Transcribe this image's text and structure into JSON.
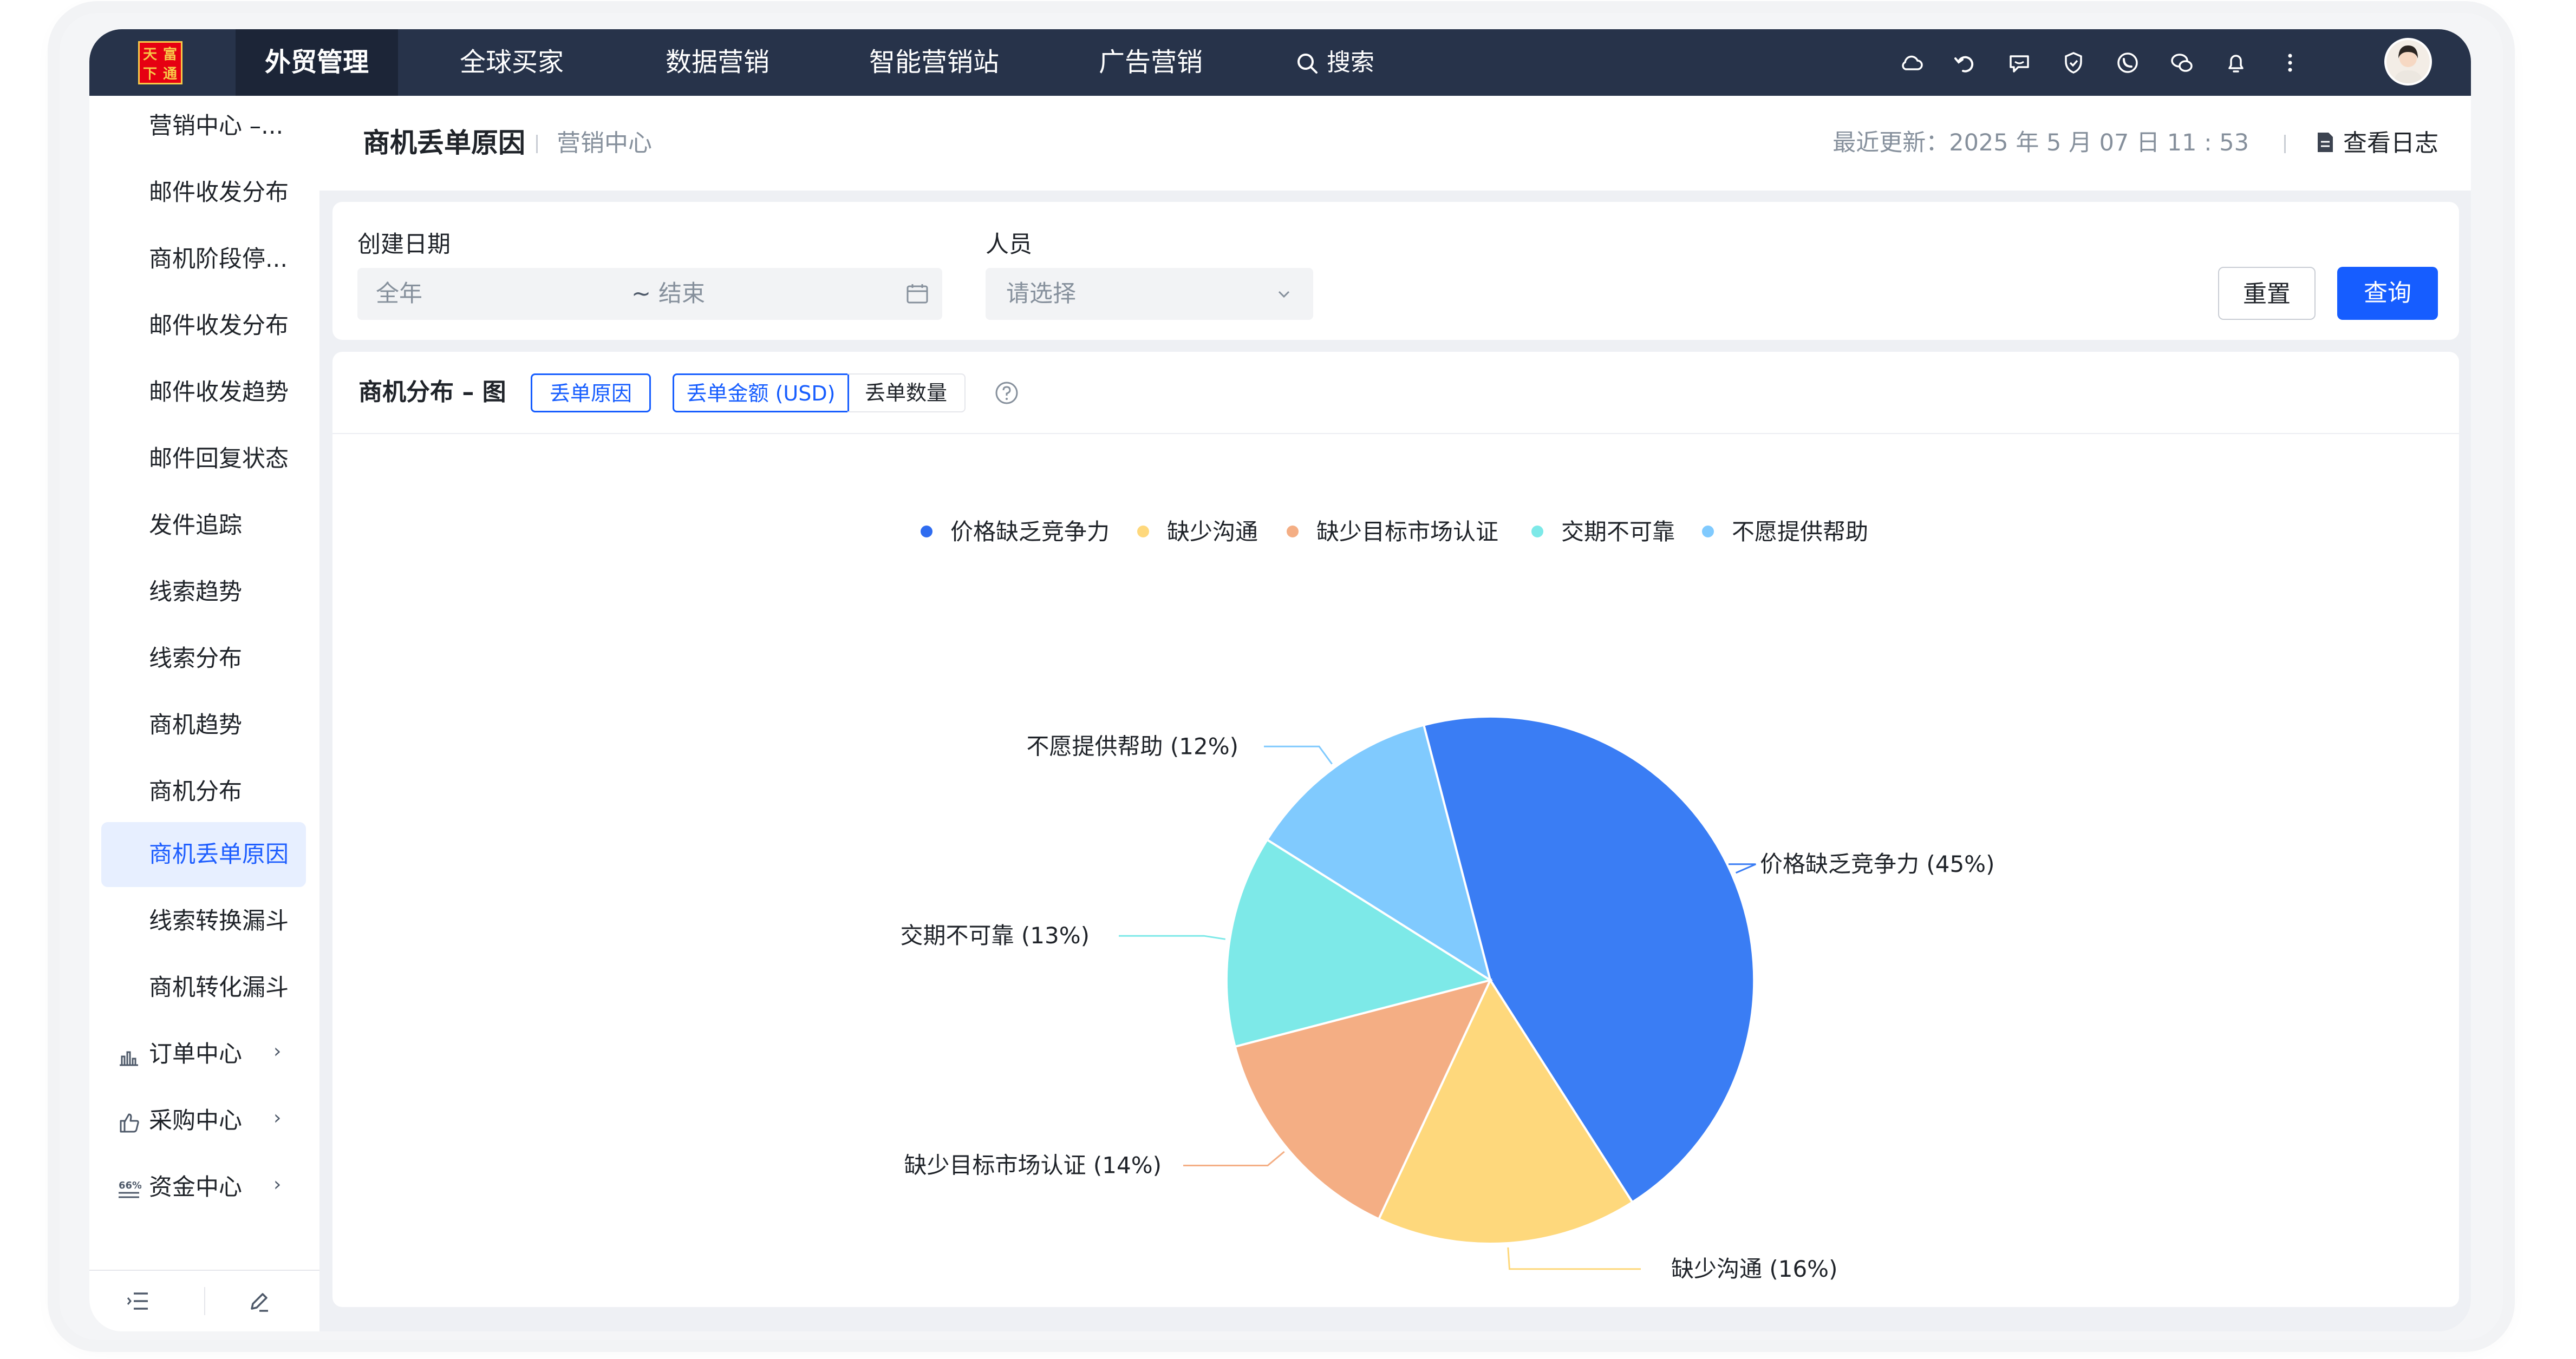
{
  "nav": {
    "logo_text": "天富下通",
    "items": [
      "外贸管理",
      "全球买家",
      "数据营销",
      "智能营销站",
      "广告营销"
    ],
    "active_index": 0,
    "search_label": "搜索",
    "tool_icons": [
      "cloud-icon",
      "refresh-icon",
      "chat-bubble-icon",
      "shield-icon",
      "whatsapp-icon",
      "wechat-icon",
      "bell-icon",
      "more-vertical-icon"
    ]
  },
  "sidebar": {
    "items": [
      "营销中心 –...",
      "邮件收发分布",
      "商机阶段停...",
      "邮件收发分布",
      "邮件收发趋势",
      "邮件回复状态",
      "发件追踪",
      "线索趋势",
      "线索分布",
      "商机趋势",
      "商机分布",
      "商机丢单原因",
      "线索转换漏斗",
      "商机转化漏斗"
    ],
    "active_index": 11,
    "groups": [
      {
        "label": "订单中心",
        "icon": "bar-chart-icon"
      },
      {
        "label": "采购中心",
        "icon": "thumbs-up-icon"
      },
      {
        "label": "资金中心",
        "icon": "percent-icon"
      }
    ]
  },
  "header": {
    "title": "商机丢单原因",
    "breadcrumb": "营销中心",
    "last_updated": "最近更新：2025 年 5 月 07 日 11 : 53",
    "log_label": "查看日志"
  },
  "filters": {
    "date_label": "创建日期",
    "date_start_placeholder": "全年",
    "date_tilde": "~",
    "date_end_placeholder": "结束",
    "person_label": "人员",
    "person_placeholder": "请选择",
    "reset_label": "重置",
    "query_label": "查询"
  },
  "chart_card": {
    "title": "商机分布 – 图",
    "tab_reason": "丢单原因",
    "tab_amount": "丢单金额 (USD)",
    "tab_count": "丢单数量"
  },
  "chart_data": {
    "type": "pie",
    "legend_position": "top",
    "slices": [
      {
        "name": "价格缺乏竞争力",
        "value": 45,
        "label": "价格缺乏竞争力 (45%)",
        "color": "#3a7df4"
      },
      {
        "name": "缺少沟通",
        "value": 16,
        "label": "缺少沟通 (16%)",
        "color": "#fed87c"
      },
      {
        "name": "缺少目标市场认证",
        "value": 14,
        "label": "缺少目标市场认证 (14%)",
        "color": "#f4ae84"
      },
      {
        "name": "交期不可靠",
        "value": 13,
        "label": "交期不可靠 (13%)",
        "color": "#7de9e8"
      },
      {
        "name": "不愿提供帮助",
        "value": 12,
        "label": "不愿提供帮助 (12%)",
        "color": "#80cafe"
      }
    ],
    "legend_dot_colors": [
      "#2f6cf0",
      "#fed87c",
      "#f4ae84",
      "#7de9e8",
      "#80cafe"
    ]
  }
}
